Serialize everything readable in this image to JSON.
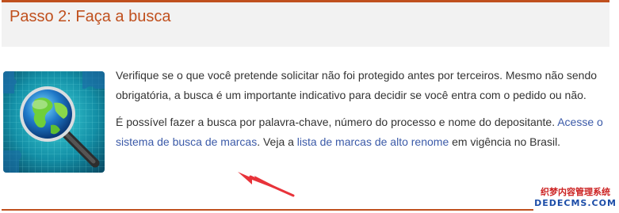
{
  "section": {
    "title": "Passo 2: Faça a busca",
    "image_icon": "globe-magnifier-icon"
  },
  "content": {
    "paragraph1": "Verifique se o que você pretende solicitar não foi protegido antes por terceiros. Mesmo não sendo obrigatória, a busca é um importante indicativo para decidir se você entra com o pedido ou não.",
    "paragraph2": {
      "text_before": "É possível fazer a busca por palavra-chave, número do processo e nome do depositante. ",
      "link1": "Acesse o sistema de busca de marcas",
      "text_middle": ". Veja a ",
      "link2": "lista de marcas de alto renome",
      "text_after": " em vigência no Brasil."
    }
  },
  "annotation": {
    "icon": "red-arrow-icon",
    "color": "#e8333a"
  },
  "watermark": {
    "line1": "织梦内容管理系统",
    "line2": "DEDECMS.COM"
  },
  "colors": {
    "accent": "#c0501e",
    "link": "#3b5aa8",
    "body_text": "#333333",
    "header_bg": "#f2f2f2"
  }
}
